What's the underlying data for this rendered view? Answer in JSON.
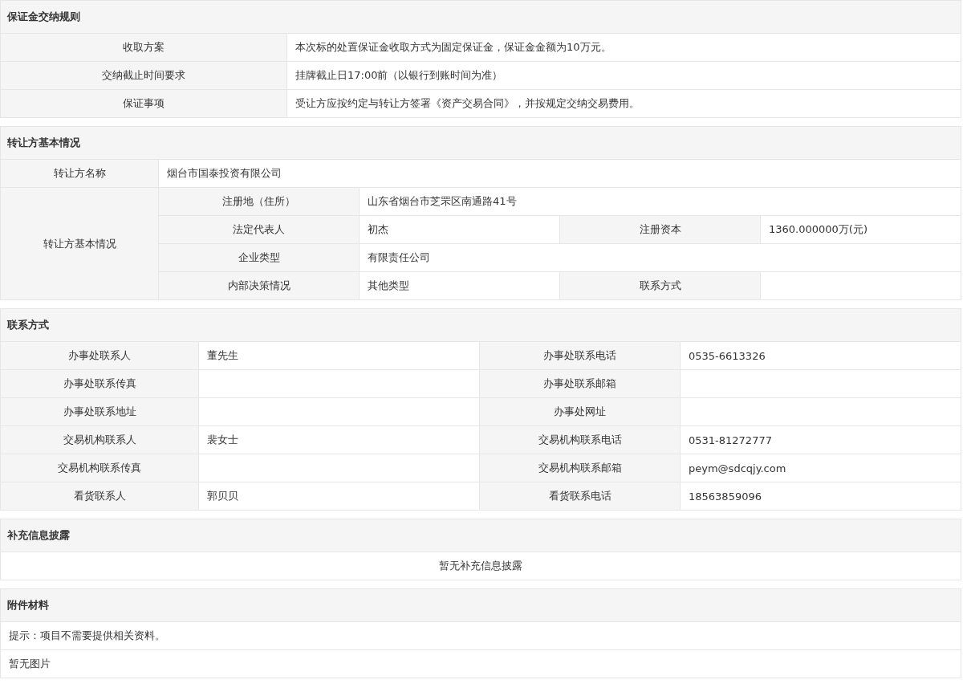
{
  "sections": [
    {
      "kind": "kv",
      "title": "保证金交纳规则",
      "rows": [
        {
          "label": "收取方案",
          "value": "本次标的处置保证金收取方式为固定保证金，保证金金额为10万元。"
        },
        {
          "label": "交纳截止时间要求",
          "value": "挂牌截止日17:00前（以银行到账时间为准）"
        },
        {
          "label": "保证事项",
          "value": "受让方应按约定与转让方签署《资产交易合同》，并按规定交纳交易费用。"
        }
      ]
    },
    {
      "kind": "party",
      "title": "转让方基本情况",
      "name_label": "转让方名称",
      "name_value": "烟台市国泰投资有限公司",
      "group_label": "转让方基本情况",
      "rows": [
        [
          {
            "label": "注册地（住所）",
            "value": "山东省烟台市芝罘区南通路41号"
          }
        ],
        [
          {
            "label": "法定代表人",
            "value": "初杰"
          },
          {
            "label": "注册资本",
            "value": "1360.000000万(元)"
          }
        ],
        [
          {
            "label": "企业类型",
            "value": "有限责任公司"
          }
        ],
        [
          {
            "label": "内部决策情况",
            "value": "其他类型"
          },
          {
            "label": "联系方式"
          }
        ]
      ]
    },
    {
      "kind": "grid",
      "title": "联系方式",
      "rows": [
        [
          {
            "label": "办事处联系人",
            "value": "董先生"
          },
          {
            "label": "办事处联系电话",
            "value": "0535-6613326"
          }
        ],
        [
          {
            "label": "办事处联系传真"
          },
          {
            "label": "办事处联系邮箱"
          }
        ],
        [
          {
            "label": "办事处联系地址"
          },
          {
            "label": "办事处网址"
          }
        ],
        [
          {
            "label": "交易机构联系人",
            "value": "裴女士"
          },
          {
            "label": "交易机构联系电话",
            "value": "0531-81272777"
          }
        ],
        [
          {
            "label": "交易机构联系传真"
          },
          {
            "label": "交易机构联系邮箱",
            "value": "peym@sdcqjy.com"
          }
        ],
        [
          {
            "label": "看货联系人",
            "value": "郭贝贝"
          },
          {
            "label": "看货联系电话",
            "value": "18563859096"
          }
        ]
      ]
    },
    {
      "kind": "notice",
      "title": "补充信息披露",
      "text": "暂无补充信息披露"
    },
    {
      "kind": "notes",
      "title": "附件材料",
      "lines": [
        "提示：项目不需要提供相关资料。",
        "暂无图片"
      ]
    }
  ]
}
